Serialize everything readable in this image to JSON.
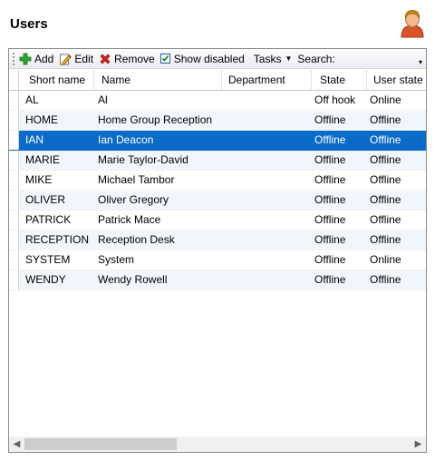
{
  "page": {
    "title": "Users"
  },
  "toolbar": {
    "add_label": "Add",
    "edit_label": "Edit",
    "remove_label": "Remove",
    "show_disabled_label": "Show disabled",
    "show_disabled_checked": true,
    "tasks_label": "Tasks",
    "search_label": "Search:"
  },
  "table": {
    "columns": [
      "Short name",
      "Name",
      "Department",
      "State",
      "User state"
    ],
    "selected_index": 2,
    "rows": [
      {
        "short": "AL",
        "name": "Al",
        "dept": "",
        "state": "Off hook",
        "ustate": "Online"
      },
      {
        "short": "HOME",
        "name": "Home Group Reception",
        "dept": "",
        "state": "Offline",
        "ustate": "Offline"
      },
      {
        "short": "IAN",
        "name": "Ian Deacon",
        "dept": "",
        "state": "Offline",
        "ustate": "Offline"
      },
      {
        "short": "MARIE",
        "name": "Marie Taylor-David",
        "dept": "",
        "state": "Offline",
        "ustate": "Offline"
      },
      {
        "short": "MIKE",
        "name": "Michael Tambor",
        "dept": "",
        "state": "Offline",
        "ustate": "Offline"
      },
      {
        "short": "OLIVER",
        "name": "Oliver Gregory",
        "dept": "",
        "state": "Offline",
        "ustate": "Offline"
      },
      {
        "short": "PATRICK",
        "name": "Patrick Mace",
        "dept": "",
        "state": "Offline",
        "ustate": "Offline"
      },
      {
        "short": "RECEPTION",
        "name": "Reception Desk",
        "dept": "",
        "state": "Offline",
        "ustate": "Offline"
      },
      {
        "short": "SYSTEM",
        "name": "System",
        "dept": "",
        "state": "Offline",
        "ustate": "Online"
      },
      {
        "short": "WENDY",
        "name": "Wendy Rowell",
        "dept": "",
        "state": "Offline",
        "ustate": "Offline"
      }
    ]
  },
  "icons": {
    "user": "user-avatar-icon",
    "add": "plus-icon",
    "edit": "edit-pencil-icon",
    "remove": "red-x-icon"
  },
  "colors": {
    "selection": "#0a6bc8",
    "alt_row": "#f1f6fc",
    "add_green": "#2fa52f",
    "remove_red": "#d8201e"
  }
}
